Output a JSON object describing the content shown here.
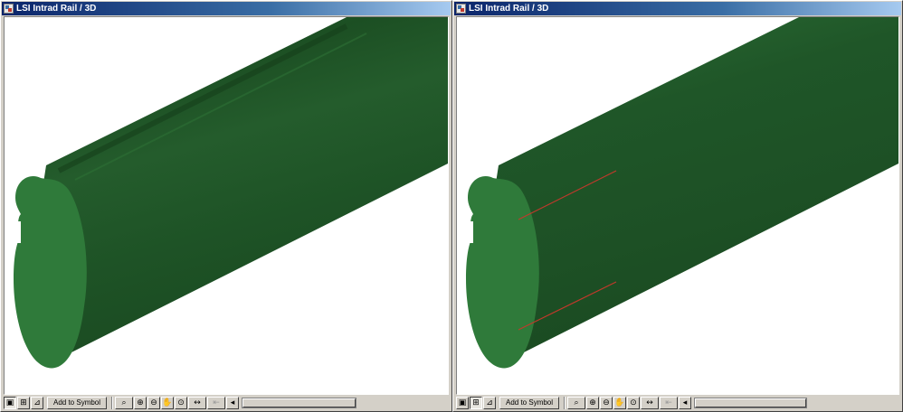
{
  "windows": [
    {
      "title": "LSI Intrad Rail / 3D",
      "toolbar": {
        "add_to_symbol_label": "Add to Symbol",
        "icons": [
          "view-3d-icon",
          "zoom-window-icon",
          "perspective-icon",
          "zoom-menu-icon",
          "zoom-in-icon",
          "zoom-out-icon",
          "pan-hand-icon",
          "fit-view-icon",
          "rotate-zoom-icon",
          "previous-view-icon",
          "scroll-left-icon"
        ]
      },
      "model": {
        "body_color": "#2f7a3a",
        "shadow_color": "#174d22",
        "selection_lines": false
      }
    },
    {
      "title": "LSI Intrad Rail / 3D",
      "toolbar": {
        "add_to_symbol_label": "Add to Symbol",
        "icons": [
          "view-3d-icon",
          "zoom-window-icon",
          "perspective-icon",
          "zoom-menu-icon",
          "zoom-in-icon",
          "zoom-out-icon",
          "pan-hand-icon",
          "fit-view-icon",
          "rotate-zoom-icon",
          "previous-view-icon",
          "scroll-left-icon"
        ]
      },
      "model": {
        "body_color": "#2f7a3a",
        "shadow_color": "#174d22",
        "selection_lines": true,
        "selection_line_color": "#c0392b"
      }
    }
  ]
}
